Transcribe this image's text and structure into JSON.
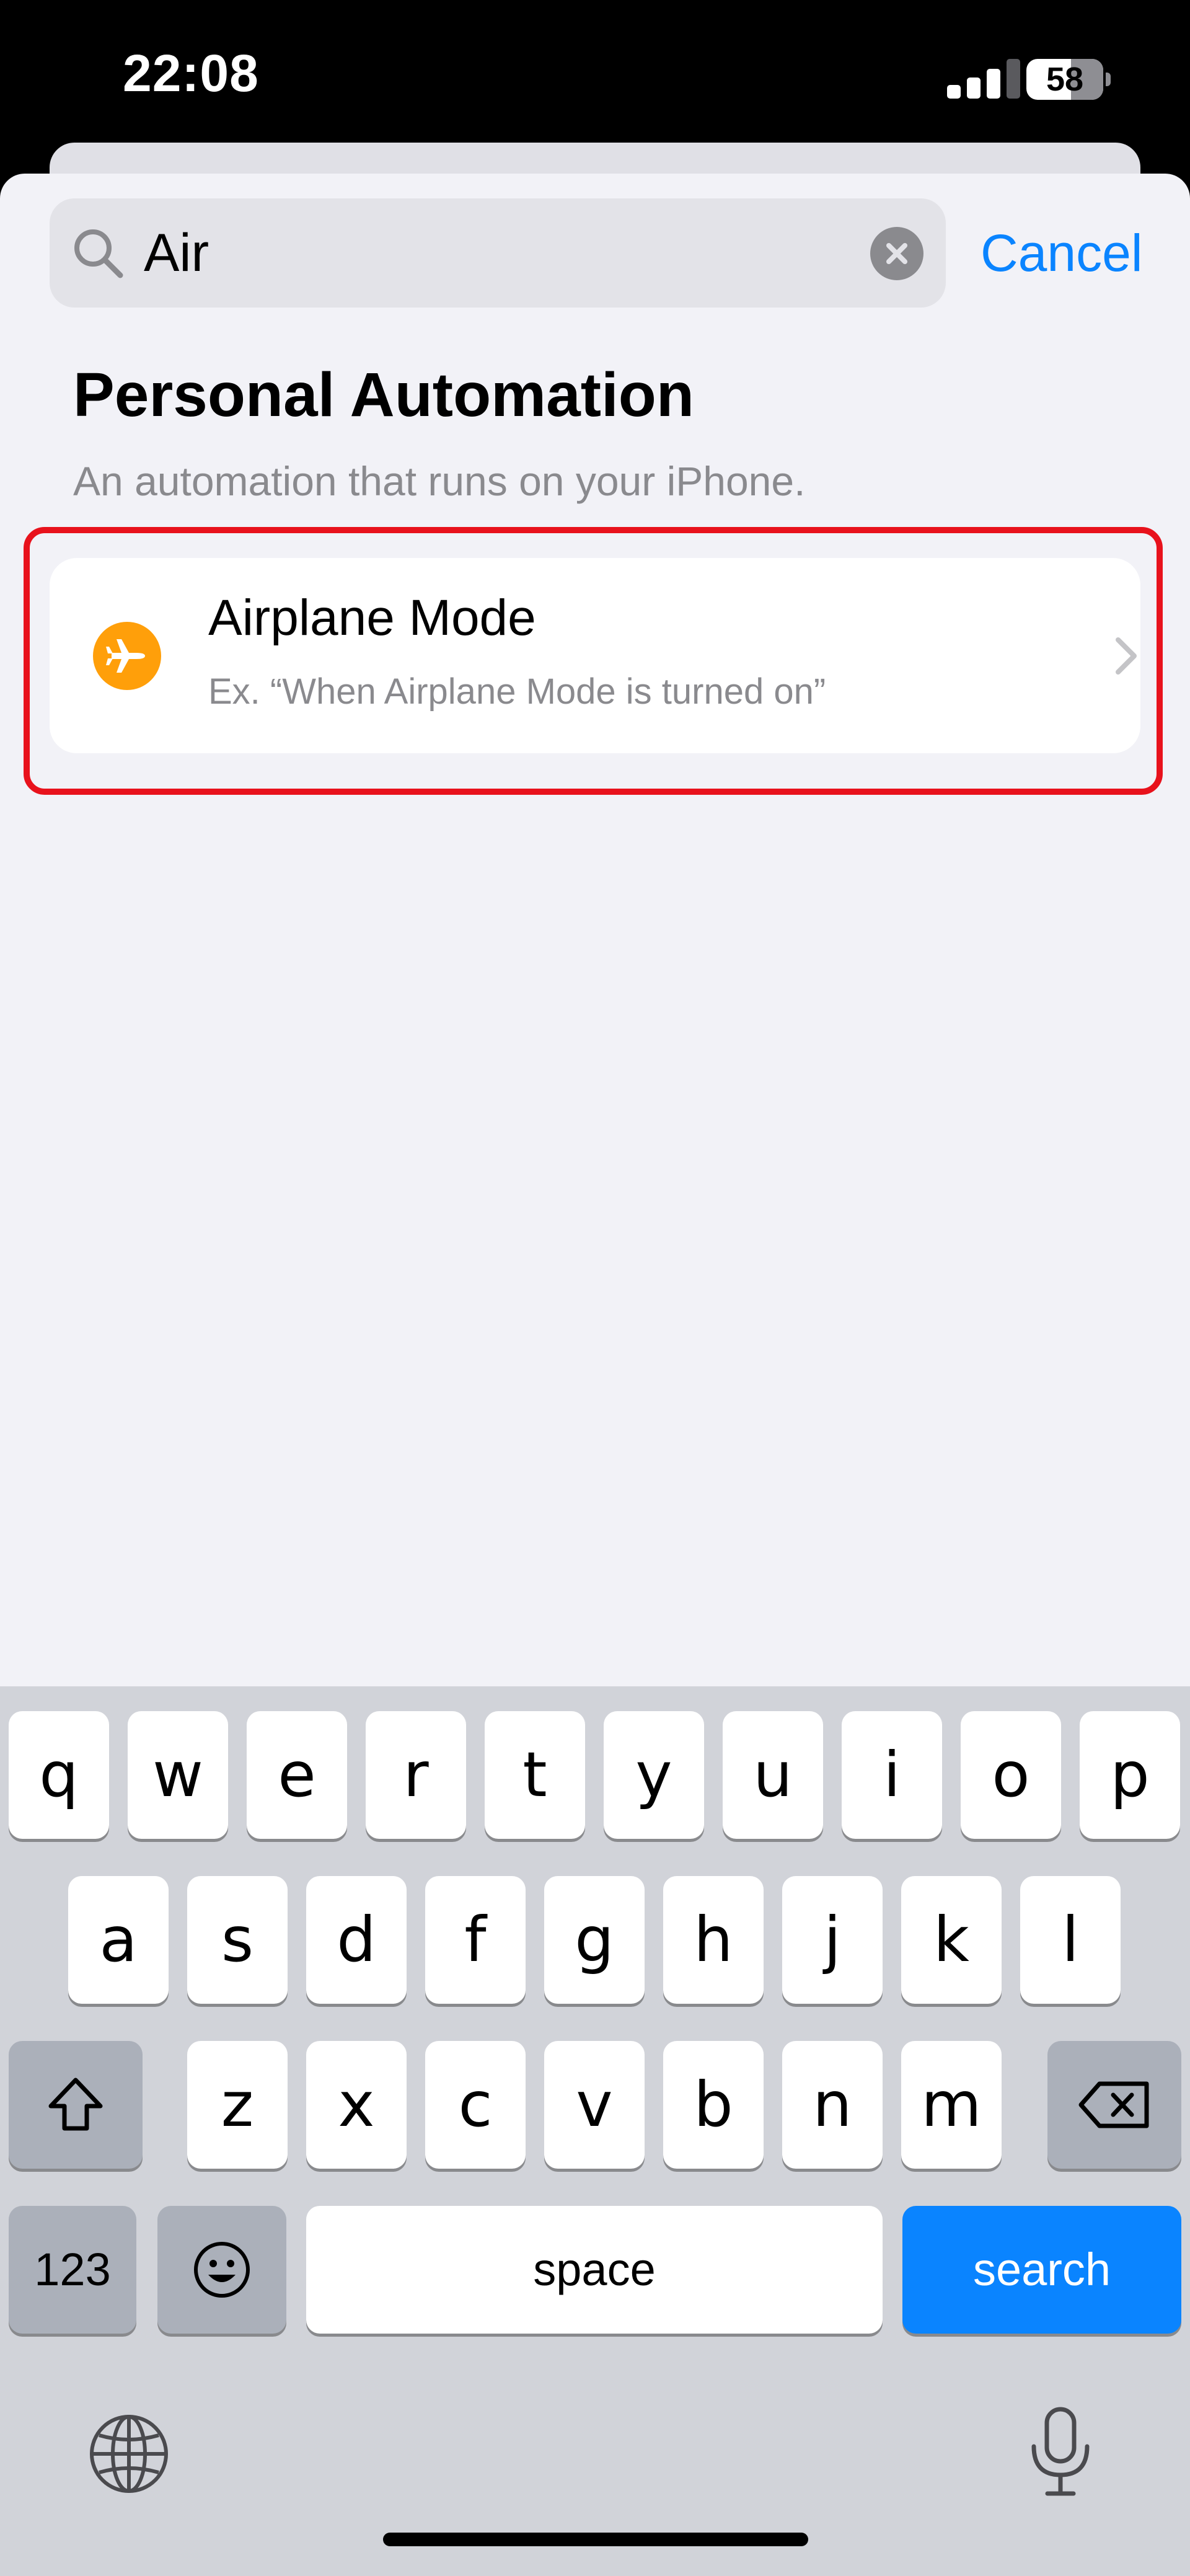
{
  "status_bar": {
    "time": "22:08",
    "battery_level": "58",
    "signal_bars": 3
  },
  "search": {
    "query": "Air",
    "cancel_label": "Cancel"
  },
  "section": {
    "title": "Personal Automation",
    "subtitle": "An automation that runs on your iPhone."
  },
  "results": [
    {
      "title": "Airplane Mode",
      "subtitle": "Ex. “When Airplane Mode is turned on”",
      "icon": "airplane-icon",
      "icon_color": "#ff9f0a"
    }
  ],
  "keyboard": {
    "row1": [
      "q",
      "w",
      "e",
      "r",
      "t",
      "y",
      "u",
      "i",
      "o",
      "p"
    ],
    "row2": [
      "a",
      "s",
      "d",
      "f",
      "g",
      "h",
      "j",
      "k",
      "l"
    ],
    "row3": [
      "z",
      "x",
      "c",
      "v",
      "b",
      "n",
      "m"
    ],
    "numbers_label": "123",
    "space_label": "space",
    "search_label": "search",
    "accent_color": "#0a84ff"
  },
  "highlight_color": "#e8121c"
}
